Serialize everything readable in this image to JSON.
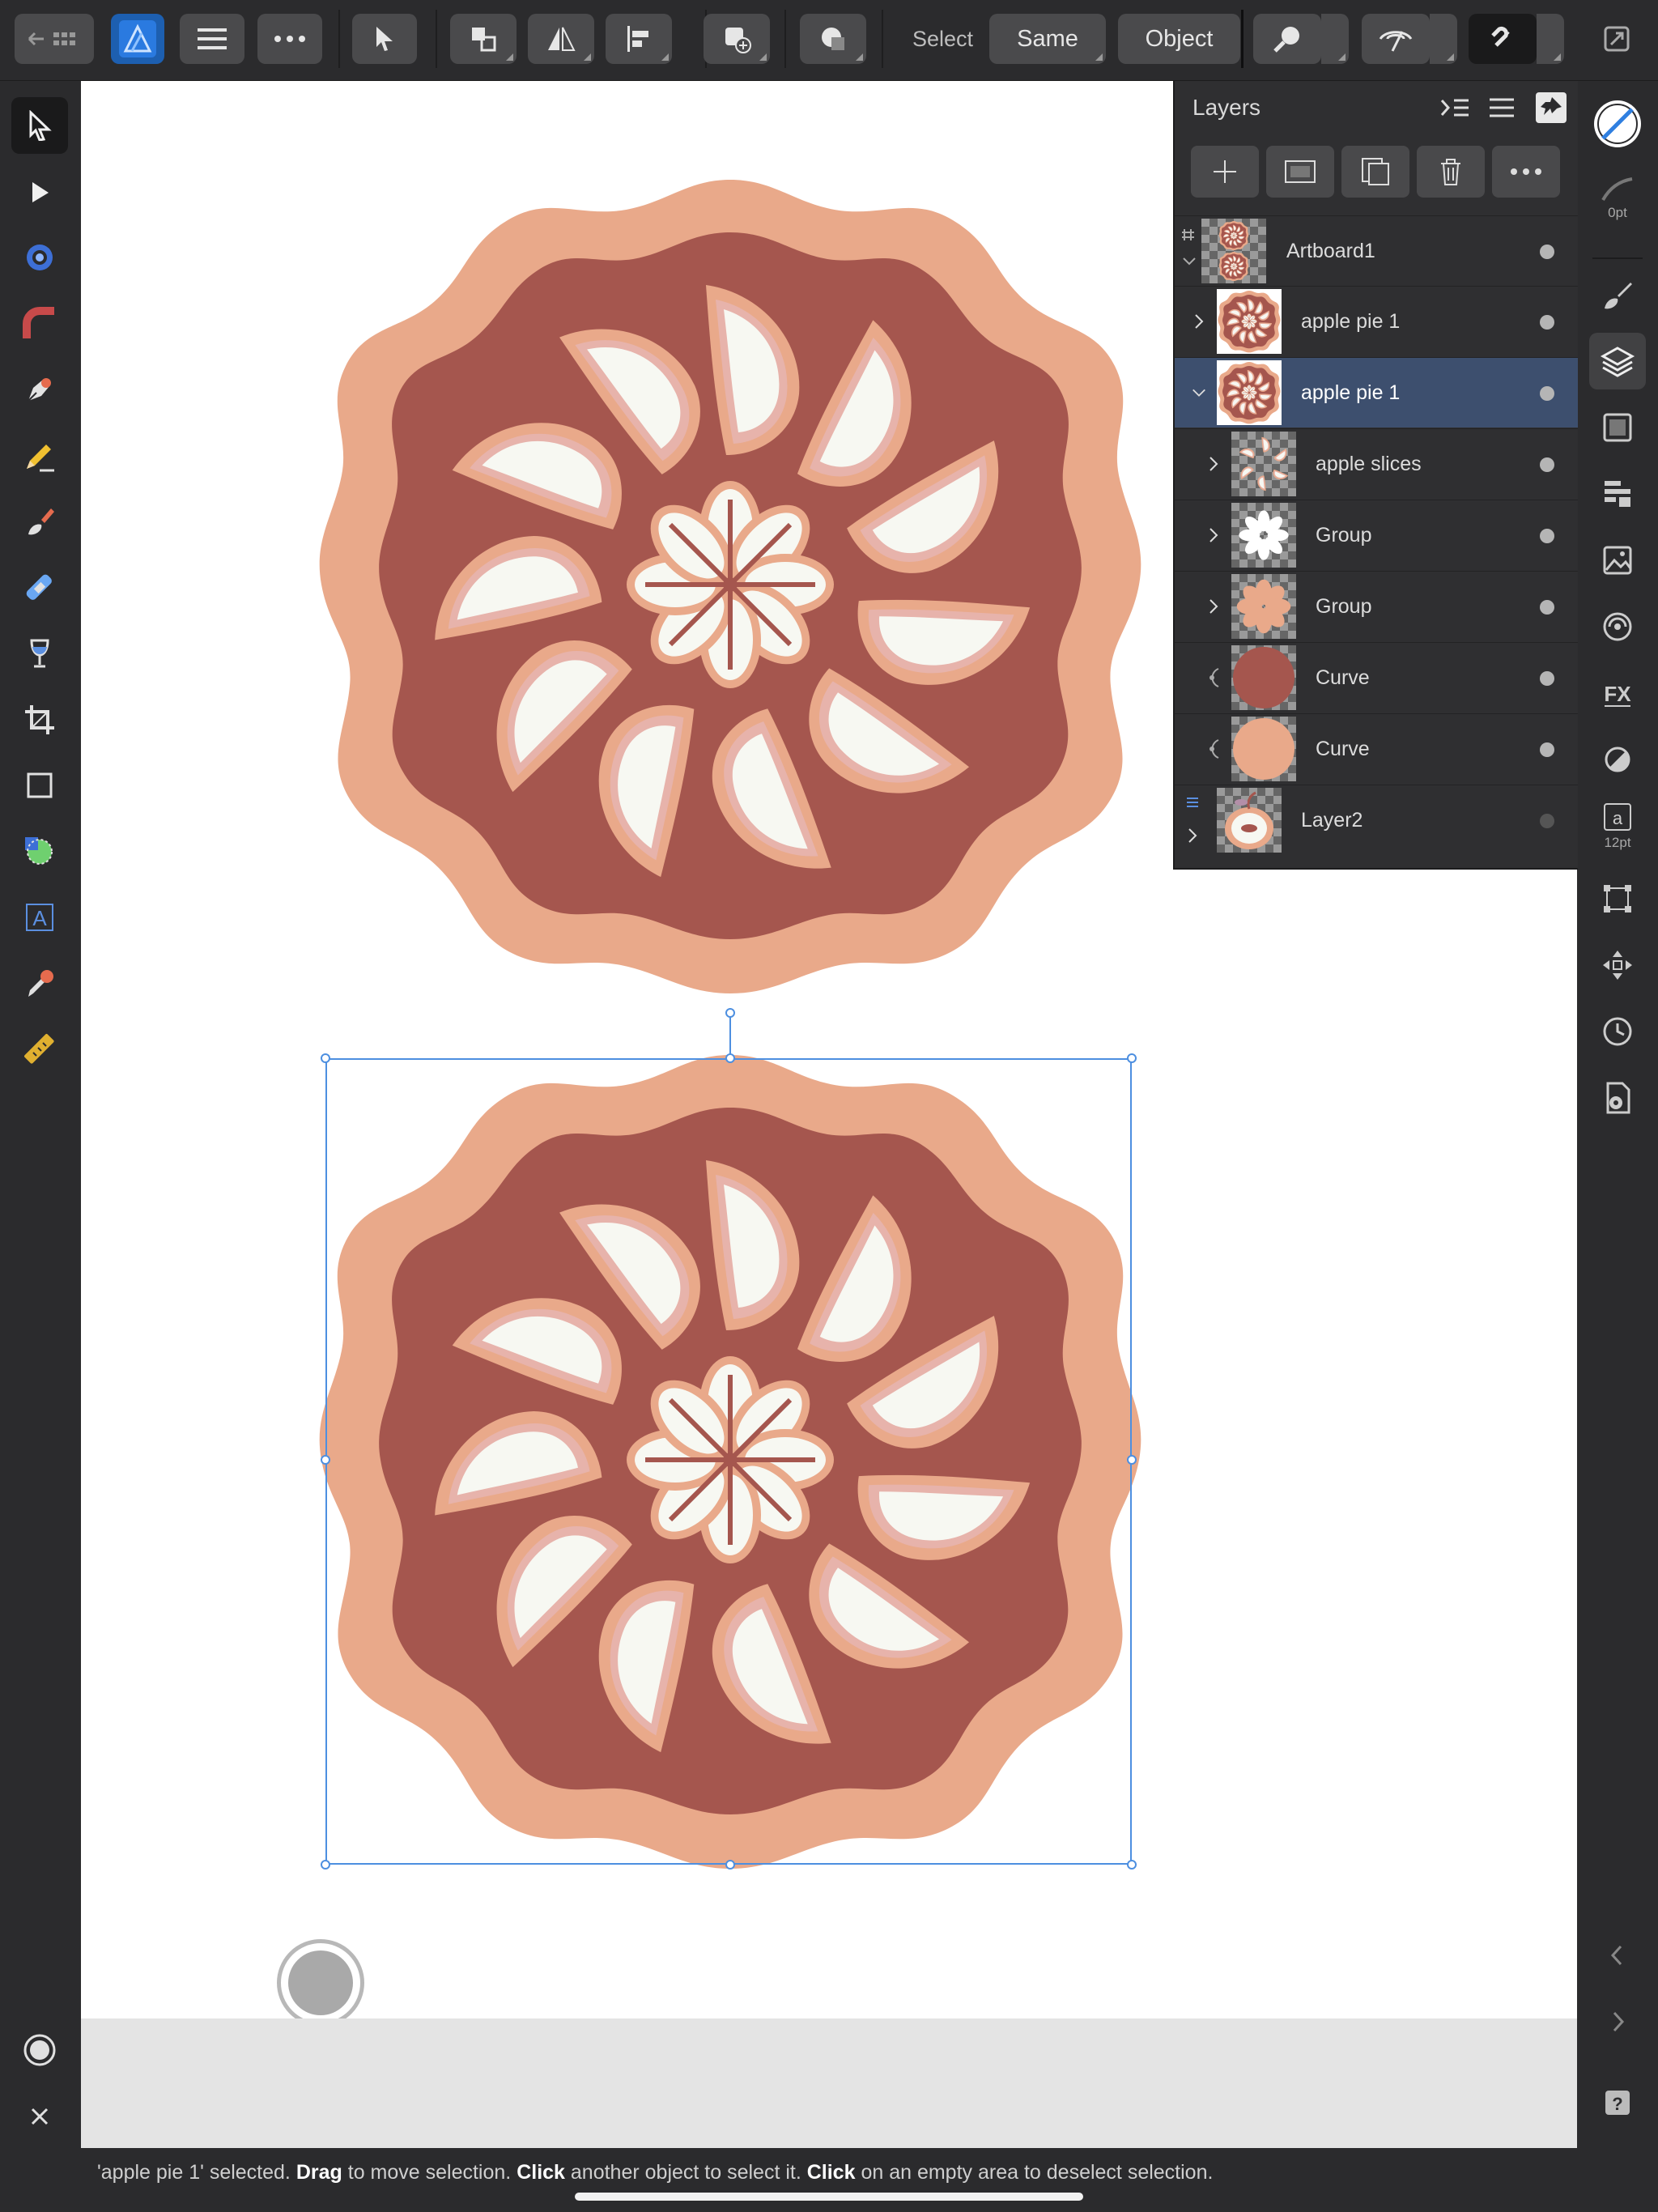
{
  "toolbar": {
    "select_label": "Select",
    "same_label": "Same",
    "object_label": "Object"
  },
  "layers_panel": {
    "title": "Layers",
    "rows": [
      {
        "name": "Artboard1"
      },
      {
        "name": "apple pie 1"
      },
      {
        "name": "apple pie 1"
      },
      {
        "name": "apple slices"
      },
      {
        "name": "Group"
      },
      {
        "name": "Group"
      },
      {
        "name": "Curve"
      },
      {
        "name": "Curve"
      },
      {
        "name": "Layer2"
      }
    ]
  },
  "right_studio": {
    "stroke_width": "0pt",
    "font_size": "12pt"
  },
  "status": {
    "part1": "'apple pie 1' selected. ",
    "bold1": "Drag",
    "part2": " to move selection. ",
    "bold2": "Click",
    "part3": " another object to select it. ",
    "bold3": "Click",
    "part4": " on an empty area to deselect selection."
  },
  "colors": {
    "crust": "#e9a98a",
    "filling": "#a5564e",
    "apple": "#f7f8f2",
    "apple_skin": "#e7a79f",
    "selection": "#4d8fe0",
    "selected_row": "#3d4f6e"
  }
}
